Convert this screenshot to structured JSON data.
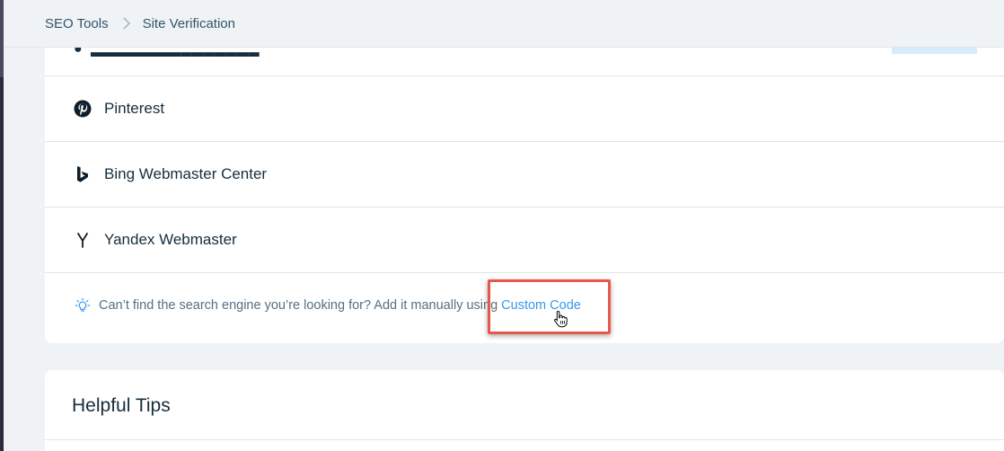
{
  "breadcrumb": {
    "items": [
      "SEO Tools",
      "Site Verification"
    ]
  },
  "verification_list": {
    "rows": [
      {
        "label": "Pinterest",
        "icon": "pinterest-icon"
      },
      {
        "label": "Bing Webmaster Center",
        "icon": "bing-icon"
      },
      {
        "label": "Yandex Webmaster",
        "icon": "yandex-icon"
      }
    ],
    "tip": {
      "text": "Can’t find the search engine you’re looking for? Add it manually using ",
      "link": "Custom Code",
      "icon": "lightbulb-icon"
    }
  },
  "helpful_tips": {
    "title": "Helpful Tips"
  },
  "colors": {
    "accent": "#3899ec",
    "highlight": "#e8574a",
    "background": "#eff3f6"
  }
}
